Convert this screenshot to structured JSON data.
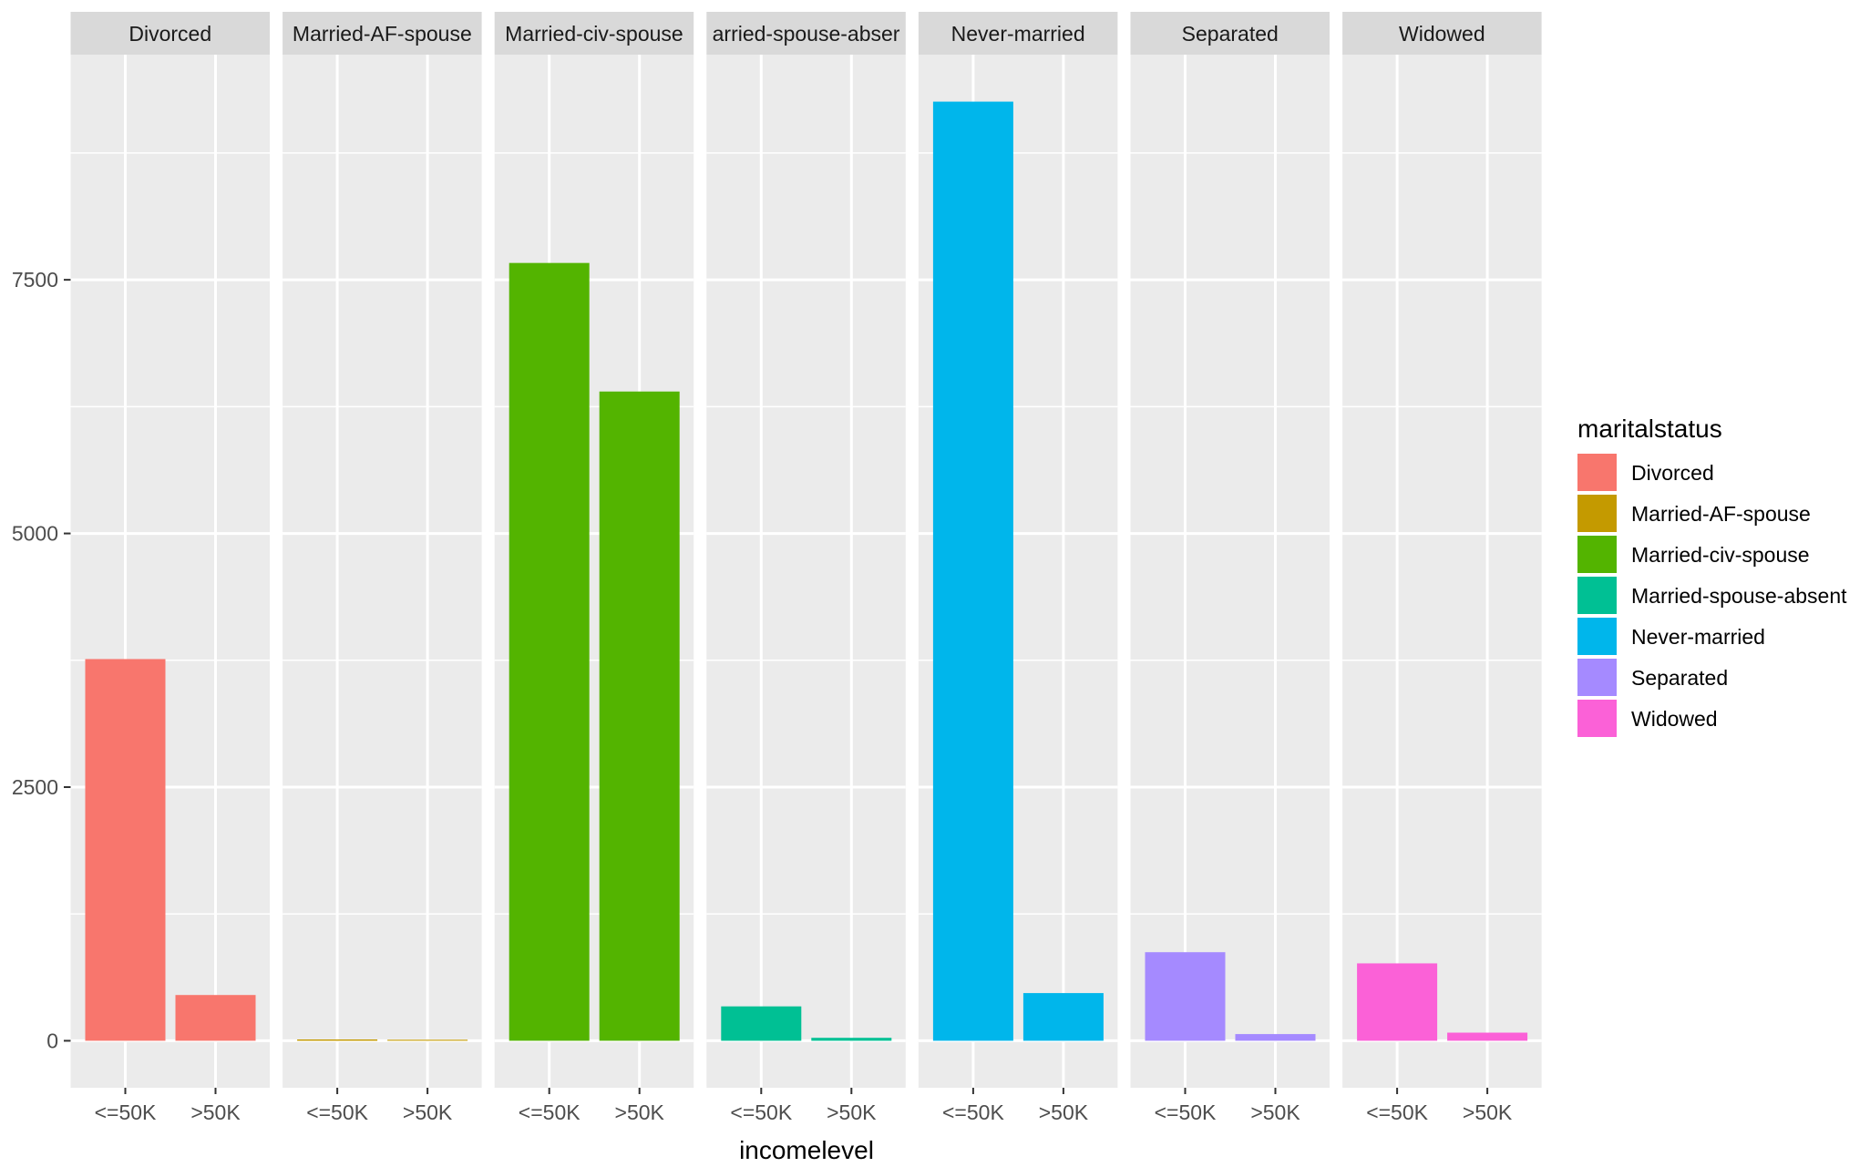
{
  "chart_data": {
    "type": "bar",
    "layout": "facet_wrap",
    "facet_variable": "maritalstatus",
    "facets": [
      "Divorced",
      "Married-AF-spouse",
      "Married-civ-spouse",
      "Married-spouse-absent",
      "Never-married",
      "Separated",
      "Widowed"
    ],
    "facet_strip_labels": [
      "Divorced",
      "Married-AF-spouse",
      "Married-civ-spouse",
      "arried-spouse-abser",
      "Never-married",
      "Separated",
      "Widowed"
    ],
    "categories": [
      "<=50K",
      ">50K"
    ],
    "series": [
      {
        "name": "Divorced",
        "color": "#F8766D",
        "values": [
          3762,
          451
        ]
      },
      {
        "name": "Married-AF-spouse",
        "color": "#C49A00",
        "values": [
          13,
          10
        ]
      },
      {
        "name": "Married-civ-spouse",
        "color": "#53B400",
        "values": [
          7666,
          6399
        ]
      },
      {
        "name": "Married-spouse-absent",
        "color": "#00C094",
        "values": [
          339,
          29
        ]
      },
      {
        "name": "Never-married",
        "color": "#00B6EB",
        "values": [
          9256,
          470
        ]
      },
      {
        "name": "Separated",
        "color": "#A58AFF",
        "values": [
          873,
          66
        ]
      },
      {
        "name": "Widowed",
        "color": "#FB61D7",
        "values": [
          763,
          80
        ]
      }
    ],
    "title": "",
    "xlabel": "incomelevel",
    "ylabel": "",
    "ylim": [
      -463,
      9719
    ],
    "yticks": [
      0,
      2500,
      5000,
      7500
    ],
    "ytick_labels": [
      "0",
      "2500",
      "5000",
      "7500"
    ],
    "grid": true,
    "legend": {
      "title": "maritalstatus",
      "placement": "right",
      "entries": [
        "Divorced",
        "Married-AF-spouse",
        "Married-civ-spouse",
        "Married-spouse-absent",
        "Never-married",
        "Separated",
        "Widowed"
      ]
    }
  },
  "colors": {
    "panel_background": "#EBEBEB",
    "strip_background": "#D9D9D9",
    "grid": "#FFFFFF"
  }
}
